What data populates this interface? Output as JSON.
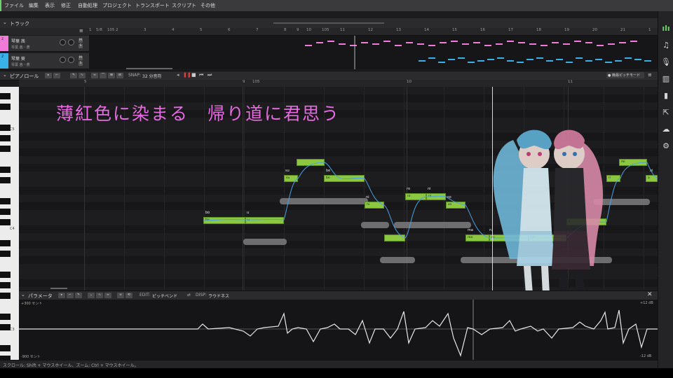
{
  "menu": {
    "items": [
      "ファイル",
      "編集",
      "表示",
      "修正",
      "自動処理",
      "プロジェクト",
      "トランスポート",
      "スクリプト",
      "その他"
    ]
  },
  "track_panel": {
    "title": "トラック",
    "ruler_numbers": [
      "1",
      "5/8",
      "105",
      "2",
      "3",
      "4",
      "5",
      "6",
      "7",
      "8",
      "9",
      "10",
      "105",
      "11",
      "12",
      "13",
      "14",
      "15",
      "16",
      "17",
      "18",
      "19",
      "20",
      "21",
      "1"
    ],
    "tracks": [
      {
        "name": "琴葉 茜",
        "sub": "琴葉 茜・蒼",
        "color": "#f07ad8",
        "num": "2"
      },
      {
        "name": "琴葉 葵",
        "sub": "琴葉 茜・蒼",
        "color": "#3ab0e8",
        "num": "2"
      }
    ],
    "ms": [
      "M",
      "S"
    ]
  },
  "piano_roll": {
    "title": "ピアノロール",
    "snap_label": "SNAP:",
    "snap_value": "32 分音符",
    "pitch_mode": "● 簡易ピッチモード",
    "ruler_numbers": [
      "5",
      "9",
      "105",
      "10",
      "11"
    ],
    "key_labels": [
      "C5",
      "C4",
      "C3"
    ],
    "lyric_overlay": "薄紅色に染まる　帰り道に君思う",
    "notes": [
      {
        "lyric": "bo",
        "ph": "bo"
      },
      {
        "lyric": "u",
        "ph": "u"
      },
      {
        "lyric": "su",
        "ph": "su"
      },
      {
        "lyric": "be",
        "ph": "be"
      },
      {
        "lyric": "ni",
        "ph": "ni"
      },
      {
        "lyric": "ro",
        "ph": "ro"
      },
      {
        "lyric": "ni",
        "ph": "ni"
      },
      {
        "lyric": "so",
        "ph": "so"
      },
      {
        "lyric": "ma",
        "ph": "ma"
      },
      {
        "lyric": "ru",
        "ph": "ru"
      },
      {
        "lyric": "ka",
        "ph": "ka"
      },
      {
        "lyric": "e",
        "ph": "e"
      },
      {
        "lyric": "ri",
        "ph": "ri"
      },
      {
        "lyric": "mi",
        "ph": "mi"
      },
      {
        "lyric": "ni",
        "ph": "ni"
      },
      {
        "lyric": "a",
        "ph": "a"
      }
    ]
  },
  "param_panel": {
    "title": "パラメータ",
    "edit_label": "EDIT:",
    "edit_value": "ピッチベンド",
    "disp_label": "DISP:",
    "disp_value": "ラウドネス",
    "top_left": "+300 セント",
    "bottom_left": "-900 セント",
    "top_right": "+12 dB",
    "bottom_right": "-12 dB"
  },
  "status": {
    "text": "スクロール: Shift + マウスホイール、ズーム: Ctrl + マウスホイール。"
  },
  "colors": {
    "note_green": "#8bc83f",
    "accent_pink": "#f07ad8",
    "accent_blue": "#3ab0e8",
    "lyric_overlay": "#e66ae0",
    "brand_green": "#6bd36b"
  },
  "icons": [
    "brand-logo-icon",
    "note-icon",
    "mic-icon",
    "library-icon",
    "book-icon",
    "export-icon",
    "cloud-icon",
    "gear-icon"
  ]
}
